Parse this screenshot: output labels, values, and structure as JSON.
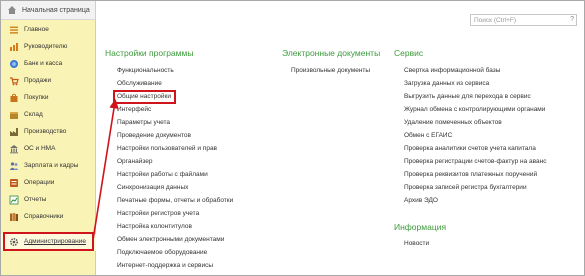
{
  "top_tab": {
    "label": "Начальная страница"
  },
  "sidebar": {
    "items": [
      {
        "label": "Главное",
        "icon": "menu-lines-icon",
        "color": "#d08a1e"
      },
      {
        "label": "Руководителю",
        "icon": "chart-bars-icon",
        "color": "#d97a1a"
      },
      {
        "label": "Банк и касса",
        "icon": "bank-coins-icon",
        "color": "#3a7bd5"
      },
      {
        "label": "Продажи",
        "icon": "cart-icon",
        "color": "#c45a18"
      },
      {
        "label": "Покупки",
        "icon": "shopping-bag-icon",
        "color": "#c8741c"
      },
      {
        "label": "Склад",
        "icon": "warehouse-box-icon",
        "color": "#b8862a"
      },
      {
        "label": "Производство",
        "icon": "factory-icon",
        "color": "#7a6a3a"
      },
      {
        "label": "ОС и НМА",
        "icon": "building-icon",
        "color": "#6f6f6f"
      },
      {
        "label": "Зарплата и кадры",
        "icon": "people-icon",
        "color": "#5a6fa8"
      },
      {
        "label": "Операции",
        "icon": "operations-icon",
        "color": "#c05a1a"
      },
      {
        "label": "Отчеты",
        "icon": "report-chart-icon",
        "color": "#2c8a3a"
      },
      {
        "label": "Справочники",
        "icon": "books-icon",
        "color": "#a8622a"
      },
      {
        "label": "Администрирование",
        "icon": "gear-icon",
        "color": "#555555"
      }
    ]
  },
  "search": {
    "placeholder": "Поиск (Ctrl+F)"
  },
  "sections": {
    "program_settings": {
      "title": "Настройки программы",
      "links": [
        "Функциональность",
        "Обслуживание",
        "Общие настройки",
        "Интерфейс",
        "Параметры учета",
        "Проведение документов",
        "Настройки пользователей и прав",
        "Органайзер",
        "Настройки работы с файлами",
        "Синхронизация данных",
        "Печатные формы, отчеты и обработки",
        "Настройки регистров учета",
        "Настройка колонтитулов",
        "Обмен электронными документами",
        "Подключаемое оборудование",
        "Интернет-поддержка и сервисы"
      ]
    },
    "edocs": {
      "title": "Электронные документы",
      "links": [
        "Произвольные документы"
      ]
    },
    "service": {
      "title": "Сервис",
      "links": [
        "Свертка информационной базы",
        "Загрузка данных из сервиса",
        "Выгрузить данные для перехода в сервис",
        "Журнал обмена с контролирующими органами",
        "Удаление помеченных объектов",
        "Обмен с ЕГАИС",
        "Проверка аналитики счетов учета капитала",
        "Проверка регистрации счетов-фактур на аванс",
        "Проверка реквизитов платежных поручений",
        "Проверка записей регистра бухгалтерии",
        "Архив ЭДО"
      ]
    },
    "info": {
      "title": "Информация",
      "links": [
        "Новости"
      ]
    }
  },
  "accent_colors": {
    "section_title": "#3c9a3c",
    "highlight": "#d0141c",
    "sidebar_bg": "#faf3b6"
  }
}
